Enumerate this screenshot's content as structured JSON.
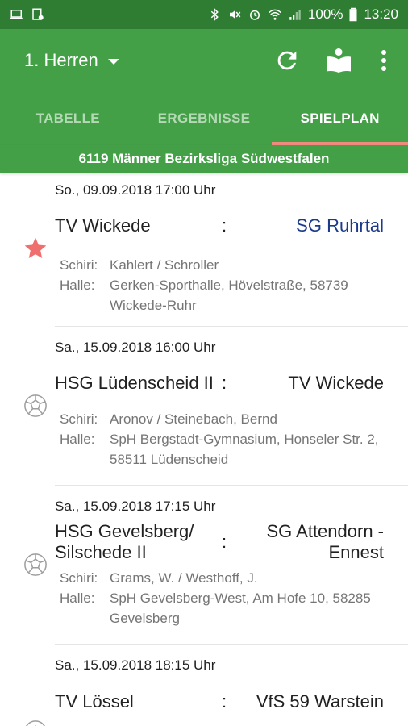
{
  "status_bar": {
    "battery_percent": "100%",
    "time": "13:20"
  },
  "app_bar": {
    "title": "1. Herren",
    "icons": [
      "refresh-icon",
      "book-icon",
      "overflow-menu-icon"
    ]
  },
  "tabs": [
    {
      "label": "TABELLE",
      "active": false
    },
    {
      "label": "ERGEBNISSE",
      "active": false
    },
    {
      "label": "SPIELPLAN",
      "active": true
    }
  ],
  "league": "6119 Männer Bezirksliga Südwestfalen",
  "colors": {
    "status_bar": "#2e7d32",
    "primary": "#43a047",
    "tab_indicator": "#ef8a7e",
    "favorite_team": "#1a3a8c",
    "star": "#ef6f6f"
  },
  "labels": {
    "referee": "Schiri:",
    "hall": "Halle:",
    "separator": ":"
  },
  "matches": [
    {
      "date": "So., 09.09.2018  17:00 Uhr",
      "home": "TV Wickede",
      "away": "SG Ruhrtal",
      "referee": "Kahlert / Schroller",
      "hall": "Gerken-Sporthalle, Hövelstraße, 58739 Wickede-Ruhr",
      "icon": "star-icon"
    },
    {
      "date": "Sa., 15.09.2018  16:00 Uhr",
      "home": "HSG Lüdenscheid II",
      "away": "TV Wickede",
      "referee": "Aronov / Steinebach, Bernd",
      "hall": "SpH Bergstadt-Gymnasium, Honseler Str. 2, 58511 Lüdenscheid",
      "icon": "handball-icon"
    },
    {
      "date": "Sa., 15.09.2018  17:15 Uhr",
      "home": "HSG Gevelsberg/ Silschede II",
      "away": "SG Attendorn -Ennest",
      "referee": "Grams, W. / Westhoff, J.",
      "hall": "SpH Gevelsberg-West, Am Hofe 10, 58285 Gevelsberg",
      "icon": "handball-icon"
    },
    {
      "date": "Sa., 15.09.2018  18:15 Uhr",
      "home": "TV Lössel",
      "away": "VfS 59 Warstein",
      "icon": "handball-icon"
    }
  ]
}
